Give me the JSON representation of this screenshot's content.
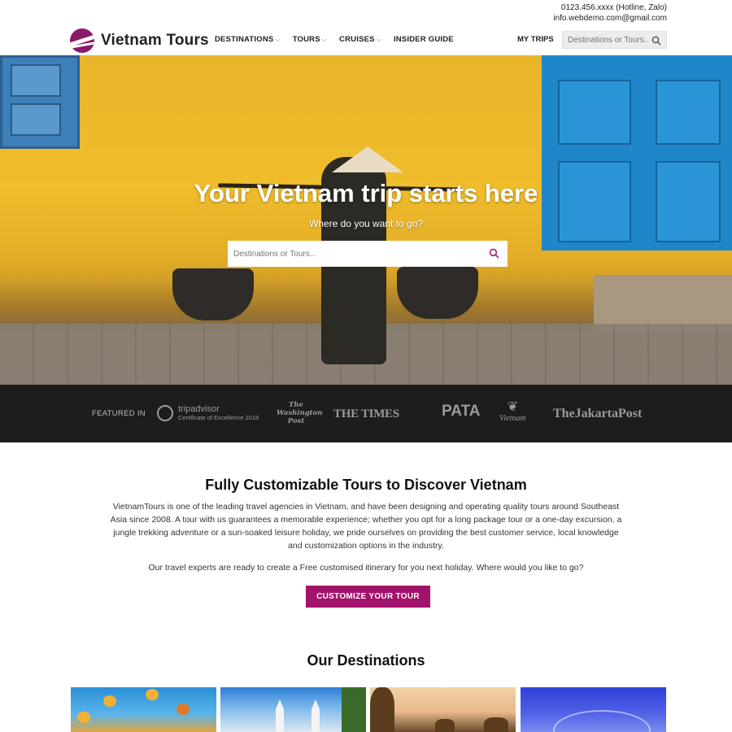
{
  "contact": {
    "phone": "0123.456.xxxx (Hotline, Zalo)",
    "email": "info.webdemo.com@gmail.com"
  },
  "header": {
    "logo_text": "Vietnam Tours",
    "nav": [
      {
        "label": "DESTINATIONS",
        "has_dropdown": true
      },
      {
        "label": "TOURS",
        "has_dropdown": true
      },
      {
        "label": "CRUISES",
        "has_dropdown": true
      },
      {
        "label": "INSIDER GUIDE",
        "has_dropdown": false
      }
    ],
    "my_trips": "MY TRIPS",
    "search_placeholder": "Destinations or Tours..."
  },
  "hero": {
    "title": "Your Vietnam trip starts here",
    "subtitle": "Where do you want to go?",
    "search_placeholder": "Destinations or Tours..."
  },
  "featured": {
    "label": "FEATURED IN",
    "tripadvisor_name": "tripadvisor",
    "tripadvisor_cert": "Certificate of Excellence 2018",
    "washington_post": "The Washington Post",
    "times": "THE TIMES",
    "pata": "PATA",
    "vietnam": "Vietnam",
    "jakarta_post": "TheJakartaPost"
  },
  "about": {
    "title": "Fully Customizable Tours to Discover Vietnam",
    "paragraph": "VietnamTours is one of the leading travel agencies in Vietnam, and have been designing and operating quality tours around Southeast Asia since 2008. A tour with us guarantees a memorable experience; whether you opt for a long package tour or a one-day excursion, a jungle trekking adventure or a sun-soaked leisure holiday, we pride ourselves on providing the best customer service, local knowledge and customization options in the industry.",
    "paragraph2": "Our travel experts are ready to create a Free customised itinerary for you next holiday. Where would you like to go?",
    "cta_label": "CUSTOMIZE YOUR TOUR"
  },
  "destinations": {
    "title": "Our Destinations"
  },
  "colors": {
    "brand": "#a3136c",
    "featured_bg": "#1d1d1d"
  }
}
